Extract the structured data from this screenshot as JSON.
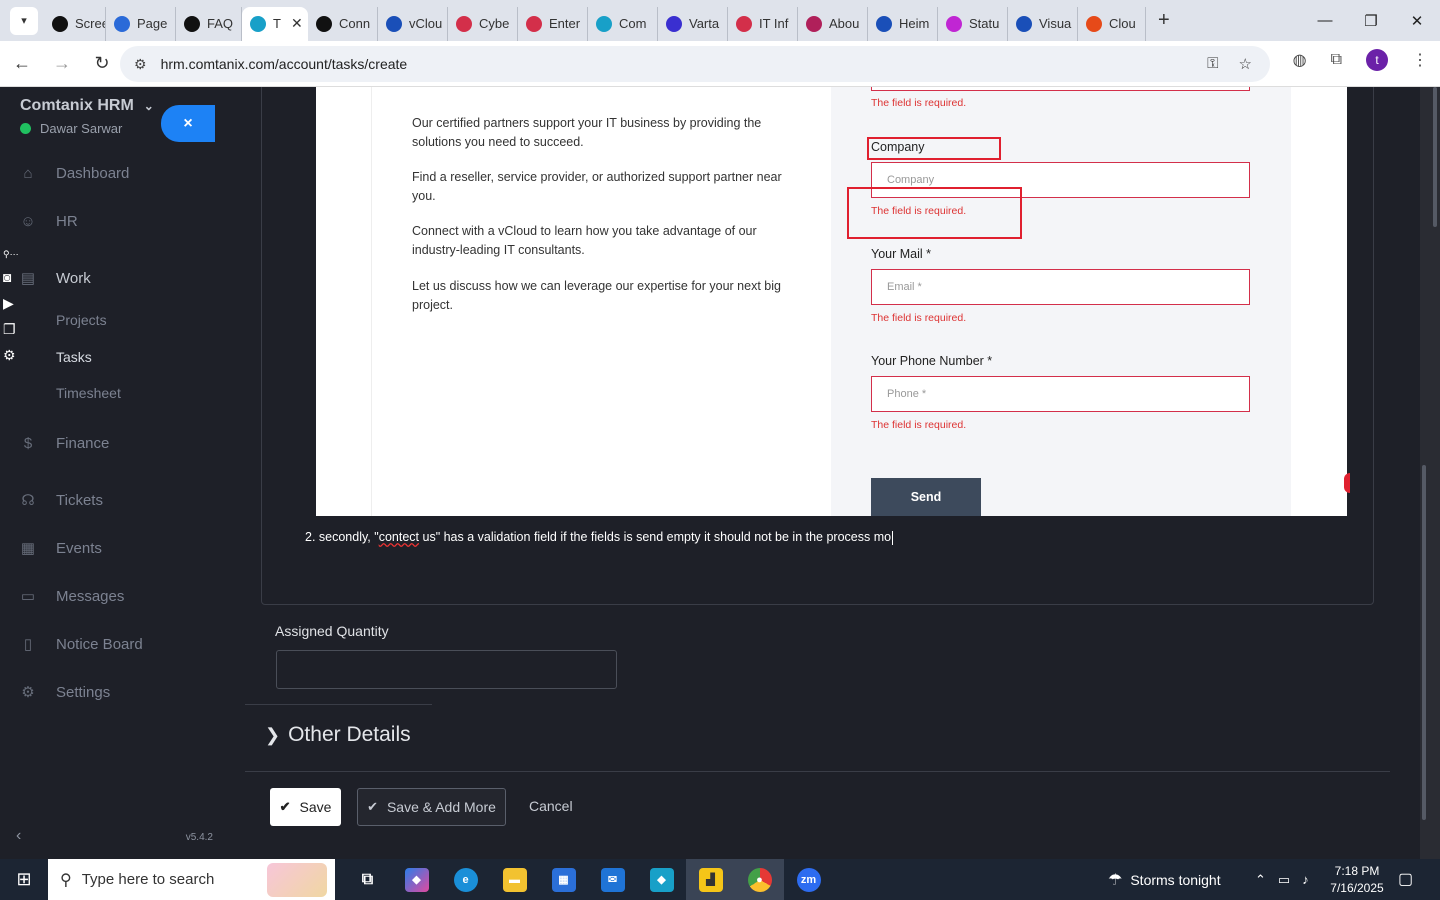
{
  "browser": {
    "tabs": [
      {
        "label": "Scree",
        "color": "#111"
      },
      {
        "label": "Page",
        "color": "#2a6ad8"
      },
      {
        "label": "FAQ",
        "color": "#111"
      },
      {
        "label": "T",
        "color": "#18a0c8",
        "active": true
      },
      {
        "label": "Conn",
        "color": "#111"
      },
      {
        "label": "vClou",
        "color": "#1a4fb8"
      },
      {
        "label": "Cybe",
        "color": "#d32f4a"
      },
      {
        "label": "Enter",
        "color": "#d32f4a"
      },
      {
        "label": "Com",
        "color": "#18a0c8"
      },
      {
        "label": "Varta",
        "color": "#3a2fd0"
      },
      {
        "label": "IT Inf",
        "color": "#d32f4a"
      },
      {
        "label": "Abou",
        "color": "#b0205a"
      },
      {
        "label": "Heim",
        "color": "#1a4fb8"
      },
      {
        "label": "Statu",
        "color": "#c026d3"
      },
      {
        "label": "Visua",
        "color": "#1a4fb8"
      },
      {
        "label": "Clou",
        "color": "#e64a19"
      }
    ],
    "url": "hrm.comtanix.com/account/tasks/create",
    "profile_initial": "t"
  },
  "sidebar": {
    "brand": "Comtanix HRM",
    "user": "Dawar Sarwar",
    "close_glyph": "×",
    "items": [
      {
        "label": "Dashboard",
        "icon": "home-icon"
      },
      {
        "label": "HR",
        "icon": "users-icon"
      },
      {
        "label": "Work",
        "icon": "briefcase-icon"
      },
      {
        "label": "Finance",
        "icon": "dollar-icon"
      },
      {
        "label": "Tickets",
        "icon": "headset-icon"
      },
      {
        "label": "Events",
        "icon": "calendar-icon"
      },
      {
        "label": "Messages",
        "icon": "message-icon"
      },
      {
        "label": "Notice Board",
        "icon": "clipboard-icon"
      },
      {
        "label": "Settings",
        "icon": "gear-icon"
      }
    ],
    "work_sub": [
      "Projects",
      "Tasks",
      "Timesheet"
    ],
    "version": "v5.4.2"
  },
  "screenshot": {
    "paragraphs": [
      "Our certified partners support your IT business by providing the solutions you need to succeed.",
      "Find a reseller, service provider, or authorized support partner near you.",
      "Connect with a vCloud to learn how you take advantage of our industry-leading IT consultants.",
      "Let us discuss how we can leverage our expertise for your next big project."
    ],
    "error": "The field is required.",
    "company_label": "Company",
    "company_placeholder": "Company",
    "mail_label": "Your Mail *",
    "mail_placeholder": "Email *",
    "phone_label": "Your Phone Number *",
    "phone_placeholder": "Phone *",
    "send": "Send"
  },
  "editor": {
    "text_before": "2. secondly, \"",
    "text_squiggle": "contect",
    "text_after": " us\" has a validation field if the fields is send empty it should not be in the process mo"
  },
  "form": {
    "assigned_quantity_label": "Assigned Quantity",
    "assigned_quantity_value": "",
    "other_details": "Other Details",
    "save": "Save",
    "save_add_more": "Save & Add More",
    "cancel": "Cancel"
  },
  "taskbar": {
    "search_placeholder": "Type here to search",
    "weather": "Storms tonight",
    "time": "7:18 PM",
    "date": "7/16/2025"
  }
}
